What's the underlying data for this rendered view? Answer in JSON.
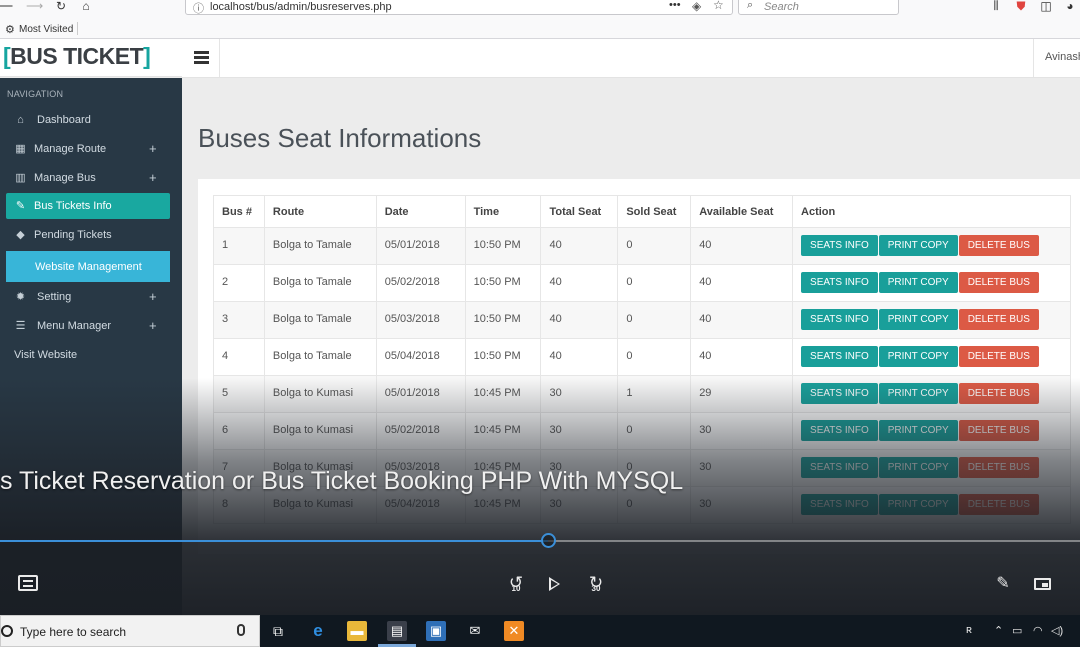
{
  "browser": {
    "url": "localhost/bus/admin/busreserves.php",
    "search_placeholder": "Search",
    "bookmark": "Most Visited"
  },
  "app": {
    "brand_text": "BUS TICKET",
    "brand_bracket_open": "[",
    "brand_bracket_close": "]",
    "user": "Avinash"
  },
  "sidebar": {
    "heading": "NAVIGATION",
    "items": [
      {
        "label": "Dashboard",
        "icon": "home-icon",
        "glyph": "⌂",
        "expandable": false
      },
      {
        "label": "Manage Route",
        "icon": "table-icon",
        "glyph": "▦",
        "expandable": true
      },
      {
        "label": "Manage Bus",
        "icon": "bar-chart-icon",
        "glyph": "▥",
        "expandable": true
      },
      {
        "label": "Bus Tickets Info",
        "icon": "edit-icon",
        "glyph": "✎",
        "expandable": false,
        "active": true
      },
      {
        "label": "Pending Tickets",
        "icon": "tag-icon",
        "glyph": "◆",
        "expandable": false
      },
      {
        "label": "Website Management",
        "icon": "",
        "glyph": "",
        "expandable": false
      },
      {
        "label": "Setting",
        "icon": "gear-icon",
        "glyph": "✹",
        "expandable": true
      },
      {
        "label": "Menu Manager",
        "icon": "list-icon",
        "glyph": "☰",
        "expandable": true
      },
      {
        "label": "Visit Website",
        "icon": "",
        "glyph": "",
        "expandable": false
      }
    ],
    "plus_glyph": "+"
  },
  "main": {
    "title": "Buses Seat Informations",
    "table": {
      "headers": [
        "Bus #",
        "Route",
        "Date",
        "Time",
        "Total Seat",
        "Sold Seat",
        "Available Seat",
        "Action"
      ],
      "rows": [
        {
          "bus": "1",
          "route": "Bolga to Tamale",
          "date": "05/01/2018",
          "time": "10:50 PM",
          "total": "40",
          "sold": "0",
          "available": "40"
        },
        {
          "bus": "2",
          "route": "Bolga to Tamale",
          "date": "05/02/2018",
          "time": "10:50 PM",
          "total": "40",
          "sold": "0",
          "available": "40"
        },
        {
          "bus": "3",
          "route": "Bolga to Tamale",
          "date": "05/03/2018",
          "time": "10:50 PM",
          "total": "40",
          "sold": "0",
          "available": "40"
        },
        {
          "bus": "4",
          "route": "Bolga to Tamale",
          "date": "05/04/2018",
          "time": "10:50 PM",
          "total": "40",
          "sold": "0",
          "available": "40"
        },
        {
          "bus": "5",
          "route": "Bolga to Kumasi",
          "date": "05/01/2018",
          "time": "10:45 PM",
          "total": "30",
          "sold": "1",
          "available": "29"
        },
        {
          "bus": "6",
          "route": "Bolga to Kumasi",
          "date": "05/02/2018",
          "time": "10:45 PM",
          "total": "30",
          "sold": "0",
          "available": "30"
        },
        {
          "bus": "7",
          "route": "Bolga to Kumasi",
          "date": "05/03/2018",
          "time": "10:45 PM",
          "total": "30",
          "sold": "0",
          "available": "30"
        },
        {
          "bus": "8",
          "route": "Bolga to Kumasi",
          "date": "05/04/2018",
          "time": "10:45 PM",
          "total": "30",
          "sold": "0",
          "available": "30"
        }
      ],
      "actions": {
        "seats": "SEATS INFO",
        "print": "PRINT COPY",
        "delete": "DELETE BUS"
      }
    }
  },
  "video": {
    "title": "s Ticket Reservation or Bus Ticket Booking PHP With MYSQL",
    "progress": 0.507,
    "rewind_seconds": "10",
    "forward_seconds": "30"
  },
  "taskbar": {
    "search_placeholder": "Type here to search"
  },
  "colors": {
    "sidebar_bg": "#283845",
    "accent_teal": "#19a8a0",
    "website_mgmt_blue": "#38b5d8",
    "delete_red": "#dc5a45",
    "progress_blue": "#3b8fd8"
  }
}
